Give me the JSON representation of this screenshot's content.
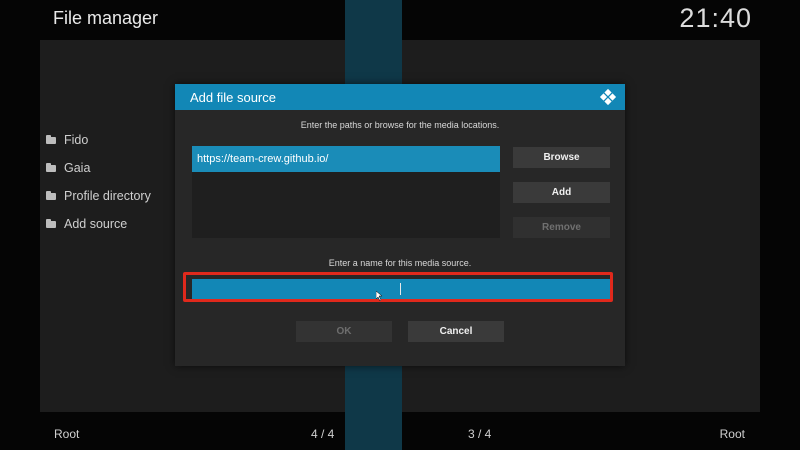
{
  "header": {
    "title": "File manager",
    "clock": "21:40"
  },
  "left_list": {
    "items": [
      {
        "label": "Fido",
        "icon": "folder-icon"
      },
      {
        "label": "Gaia",
        "icon": "folder-icon"
      },
      {
        "label": "Profile directory",
        "icon": "folder-icon"
      },
      {
        "label": "Add source",
        "icon": "folder-icon"
      }
    ]
  },
  "footer": {
    "left_root": "Root",
    "left_page": "4 / 4",
    "right_page": "3 / 4",
    "right_root": "Root"
  },
  "dialog": {
    "title": "Add file source",
    "icon": "kodi-logo-icon",
    "paths_instruction": "Enter the paths or browse for the media locations.",
    "paths": [
      "https://team-crew.github.io/"
    ],
    "buttons": {
      "browse": "Browse",
      "add": "Add",
      "remove": "Remove",
      "ok": "OK",
      "cancel": "Cancel"
    },
    "name_instruction": "Enter a name for this media source.",
    "name_value": ""
  },
  "colors": {
    "accent": "#1287b6",
    "highlight_border": "#e0291c",
    "center_strip": "#0f3848"
  }
}
